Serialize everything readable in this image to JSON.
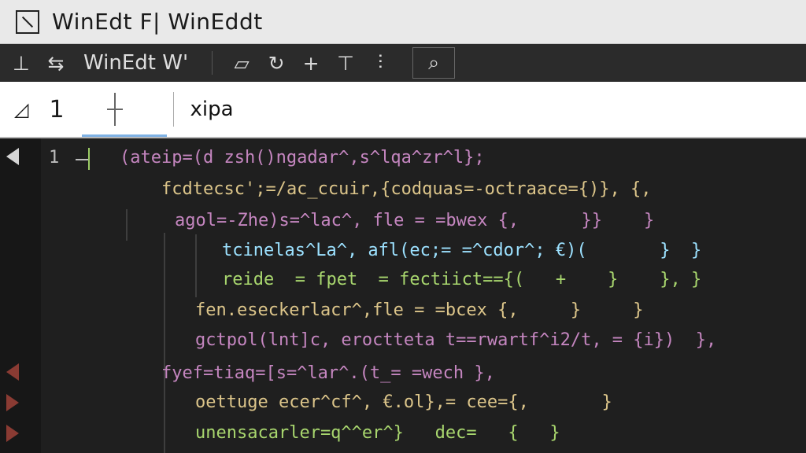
{
  "window": {
    "title": "WinEdt F| WinEddt"
  },
  "toolbar": {
    "label": "WinEdt  W'",
    "icons": [
      "align-icon",
      "format-icon",
      "marker-icon",
      "refresh-icon",
      "plus-icon",
      "table-icon",
      "indent-icon",
      "search-icon"
    ]
  },
  "searchbar": {
    "line": "1",
    "value": "xipa"
  },
  "editor": {
    "line_number": "1",
    "lines": [
      "(ateip=(d zsh()ngadar^,s^lqa^zr^l};",
      "fcdtecsc';=/ac_ccuir,{codquas=-octraace={)}, {,",
      "agol=-Zhe)s=^lac^, fle = =bwex {,      }}    }",
      "tcinelas^La^, afl(ec;= =^cdor^; €)(       }  }",
      "reide  = fpet  = fectiict=={(   +    }    }, }",
      "fen.eseckerlacr^,fle = =bcex {,     }     }",
      "gctpol(lnt]c, eroctteta t==rwartf^i2/t, = {i})  },",
      "fyef=tiaq=[s=^lar^.(t_= =wech },",
      "oettuge ecer^cf^, €.ol},= cee={,       }",
      "unensacarler=q^^er^}   dec=   {   }"
    ]
  },
  "colors": {
    "accent": "#7fb2e5",
    "background": "#1f1f1f"
  }
}
